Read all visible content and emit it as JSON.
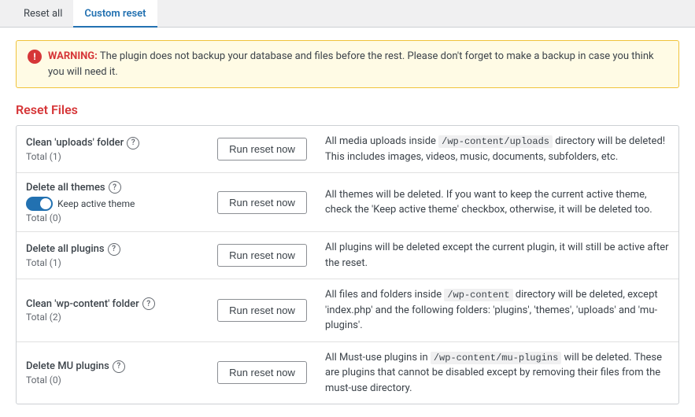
{
  "tabs": [
    {
      "id": "reset-all",
      "label": "Reset all",
      "active": false
    },
    {
      "id": "custom-reset",
      "label": "Custom reset",
      "active": true
    }
  ],
  "warning": {
    "icon": "!",
    "label_strong": "WARNING:",
    "text": " The plugin does not backup your database and files before the rest. Please don't forget to make a backup in case you think you will need it."
  },
  "section_title": "Reset Files",
  "rows": [
    {
      "id": "uploads",
      "title": "Clean 'uploads' folder",
      "total": "Total (1)",
      "button_label": "Run reset now",
      "has_toggle": false,
      "description": "All media uploads inside <code>/wp-content/uploads</code> directory will be deleted! This includes images, videos, music, documents, subfolders, etc."
    },
    {
      "id": "themes",
      "title": "Delete all themes",
      "total": "Total (0)",
      "button_label": "Run reset now",
      "has_toggle": true,
      "toggle_label": "Keep active theme",
      "toggle_on": true,
      "description": "All themes will be deleted. If you want to keep the current active theme, check the 'Keep active theme' checkbox, otherwise, it will be deleted too."
    },
    {
      "id": "plugins",
      "title": "Delete all plugins",
      "total": "Total (1)",
      "button_label": "Run reset now",
      "has_toggle": false,
      "description": "All plugins will be deleted except the current plugin, it will still be active after the reset."
    },
    {
      "id": "wp-content",
      "title": "Clean 'wp-content' folder",
      "total": "Total (2)",
      "button_label": "Run reset now",
      "has_toggle": false,
      "description": "All files and folders inside <code>/wp-content</code> directory will be deleted, except 'index.php' and the following folders: 'plugins', 'themes', 'uploads' and 'mu-plugins'."
    },
    {
      "id": "mu-plugins",
      "title": "Delete MU plugins",
      "total": "Total (0)",
      "button_label": "Run reset now",
      "has_toggle": false,
      "description": "All Must-use plugins in <code>/wp-content/mu-plugins</code> will be deleted. These are plugins that cannot be disabled except by removing their files from the must-use directory."
    }
  ]
}
